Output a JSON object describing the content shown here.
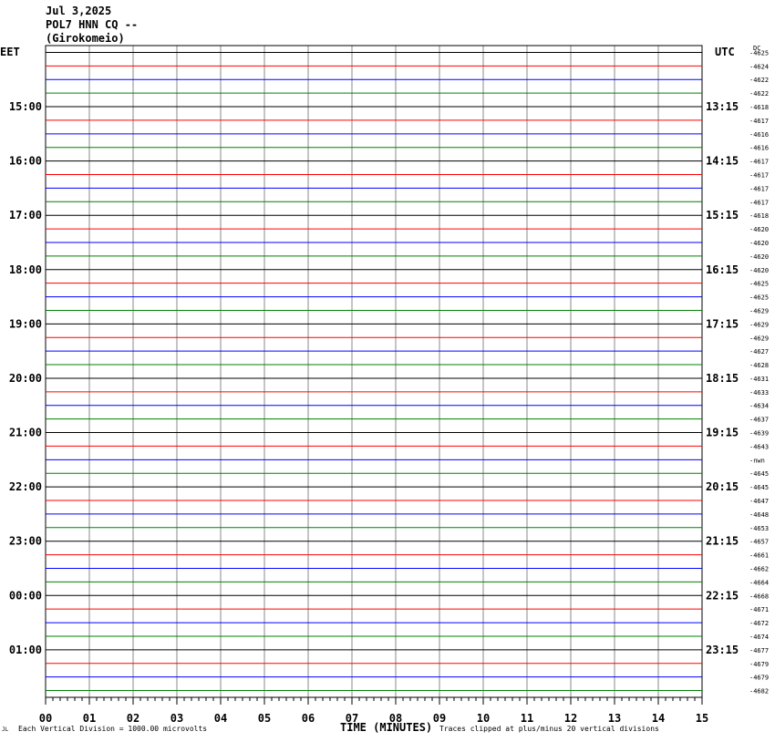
{
  "header": {
    "date": "Jul 3,2025",
    "station": "POL7 HNN CQ --",
    "location": "(Girokomeio)"
  },
  "left_tz": "EET",
  "right_tz": "UTC",
  "dc_label": "DC",
  "footer": {
    "corner_mark": "JL",
    "scale_note": "Each Vertical Division = 1000.00 microvolts",
    "xlabel": "TIME (MINUTES)",
    "clip_note": "Traces clipped at plus/minus 20 vertical divisions"
  },
  "chart_data": {
    "type": "line",
    "title": "POL7 HNN CQ -- (Girokomeio)",
    "xlabel": "TIME (MINUTES)",
    "xlim": [
      0,
      15
    ],
    "x_ticks": [
      "00",
      "01",
      "02",
      "03",
      "04",
      "05",
      "06",
      "07",
      "08",
      "09",
      "10",
      "11",
      "12",
      "13",
      "14",
      "15"
    ],
    "grid": true,
    "trace_colors": [
      "#000000",
      "#ff0000",
      "#0000ff",
      "#008000"
    ],
    "left_time_labels": [
      "15:00",
      "16:00",
      "17:00",
      "18:00",
      "19:00",
      "20:00",
      "21:00",
      "22:00",
      "23:00",
      "00:00",
      "01:00"
    ],
    "right_time_labels": [
      "13:15",
      "14:15",
      "15:15",
      "16:15",
      "17:15",
      "18:15",
      "19:15",
      "20:15",
      "21:15",
      "22:15",
      "23:15"
    ],
    "dc_offsets": [
      "-4625",
      "-4624",
      "-4622",
      "-4622",
      "-4618",
      "-4617",
      "-4616",
      "-4616",
      "-4617",
      "-4617",
      "-4617",
      "-4617",
      "-4618",
      "-4620",
      "-4620",
      "-4620",
      "-4620",
      "-4625",
      "-4625",
      "-4629",
      "-4629",
      "-4629",
      "-4627",
      "-4628",
      "-4631",
      "-4633",
      "-4634",
      "-4637",
      "-4639",
      "-4643",
      "-nwn",
      "-4645",
      "-4645",
      "-4647",
      "-4648",
      "-4653",
      "-4657",
      "-4661",
      "-4662",
      "-4664",
      "-4668",
      "-4671",
      "-4672",
      "-4674",
      "-4677",
      "-4679",
      "-4679",
      "-4682"
    ]
  }
}
